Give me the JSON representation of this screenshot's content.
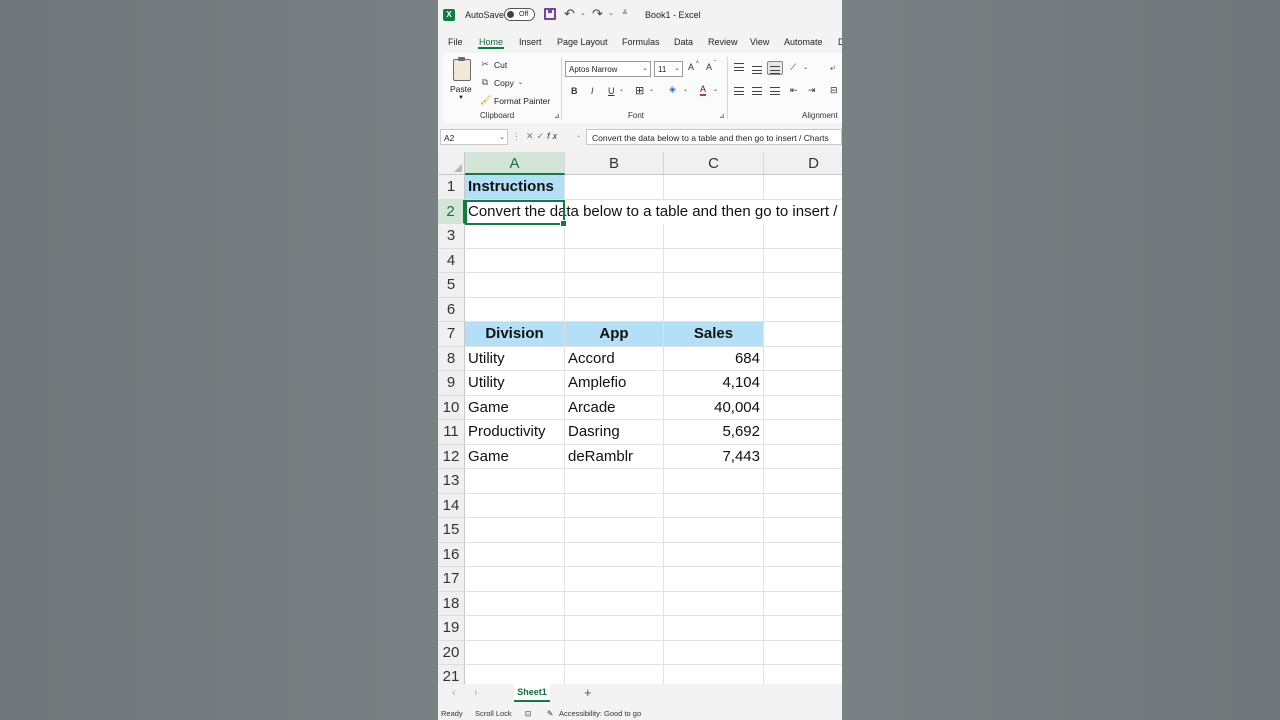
{
  "titlebar": {
    "logo": "X",
    "autosave_label": "AutoSave",
    "autosave_state": "Off",
    "doc_title": "Book1  -  Excel",
    "icons": [
      "excel-logo-icon",
      "save-icon",
      "undo-icon",
      "redo-icon",
      "customize-icon"
    ]
  },
  "tabs": [
    "File",
    "Home",
    "Insert",
    "Page Layout",
    "Formulas",
    "Data",
    "Review",
    "View",
    "Automate",
    "D"
  ],
  "ribbon": {
    "clipboard": {
      "paste": "Paste",
      "cut": "Cut",
      "copy": "Copy",
      "format_painter": "Format Painter",
      "label": "Clipboard"
    },
    "font": {
      "name": "Aptos Narrow",
      "size": "11",
      "grow": "A",
      "shrink": "A",
      "bold": "B",
      "italic": "I",
      "underline": "U",
      "color_letter": "A",
      "label": "Font"
    },
    "alignment": {
      "label": "Alignment"
    }
  },
  "formula_bar": {
    "name_box": "A2",
    "fx": "fx",
    "content": "Convert the data below to a table and then go to insert / Charts"
  },
  "columns": [
    "A",
    "B",
    "C",
    "D"
  ],
  "rows": [
    "1",
    "2",
    "3",
    "4",
    "5",
    "6",
    "7",
    "8",
    "9",
    "10",
    "11",
    "12",
    "13",
    "14",
    "15",
    "16",
    "17",
    "18",
    "19",
    "20",
    "21"
  ],
  "cells": {
    "a1": "Instructions",
    "a2": "Convert the data below to a table and then go to insert / Charts"
  },
  "table": {
    "headers": [
      "Division",
      "App",
      "Sales"
    ],
    "rows": [
      [
        "Utility",
        "Accord",
        "684"
      ],
      [
        "Utility",
        "Amplefio",
        "4,104"
      ],
      [
        "Game",
        "Arcade",
        "40,004"
      ],
      [
        "Productivity",
        "Dasring",
        "5,692"
      ],
      [
        "Game",
        "deRamblr",
        "7,443"
      ]
    ]
  },
  "sheets": [
    "Sheet1"
  ],
  "add_sheet": "+",
  "status": {
    "ready": "Ready",
    "scroll_lock": "Scroll Lock",
    "accessibility": "Accessibility: Good to go"
  },
  "colors": {
    "accent": "#107c41",
    "header_fill": "#b3e0f7"
  }
}
